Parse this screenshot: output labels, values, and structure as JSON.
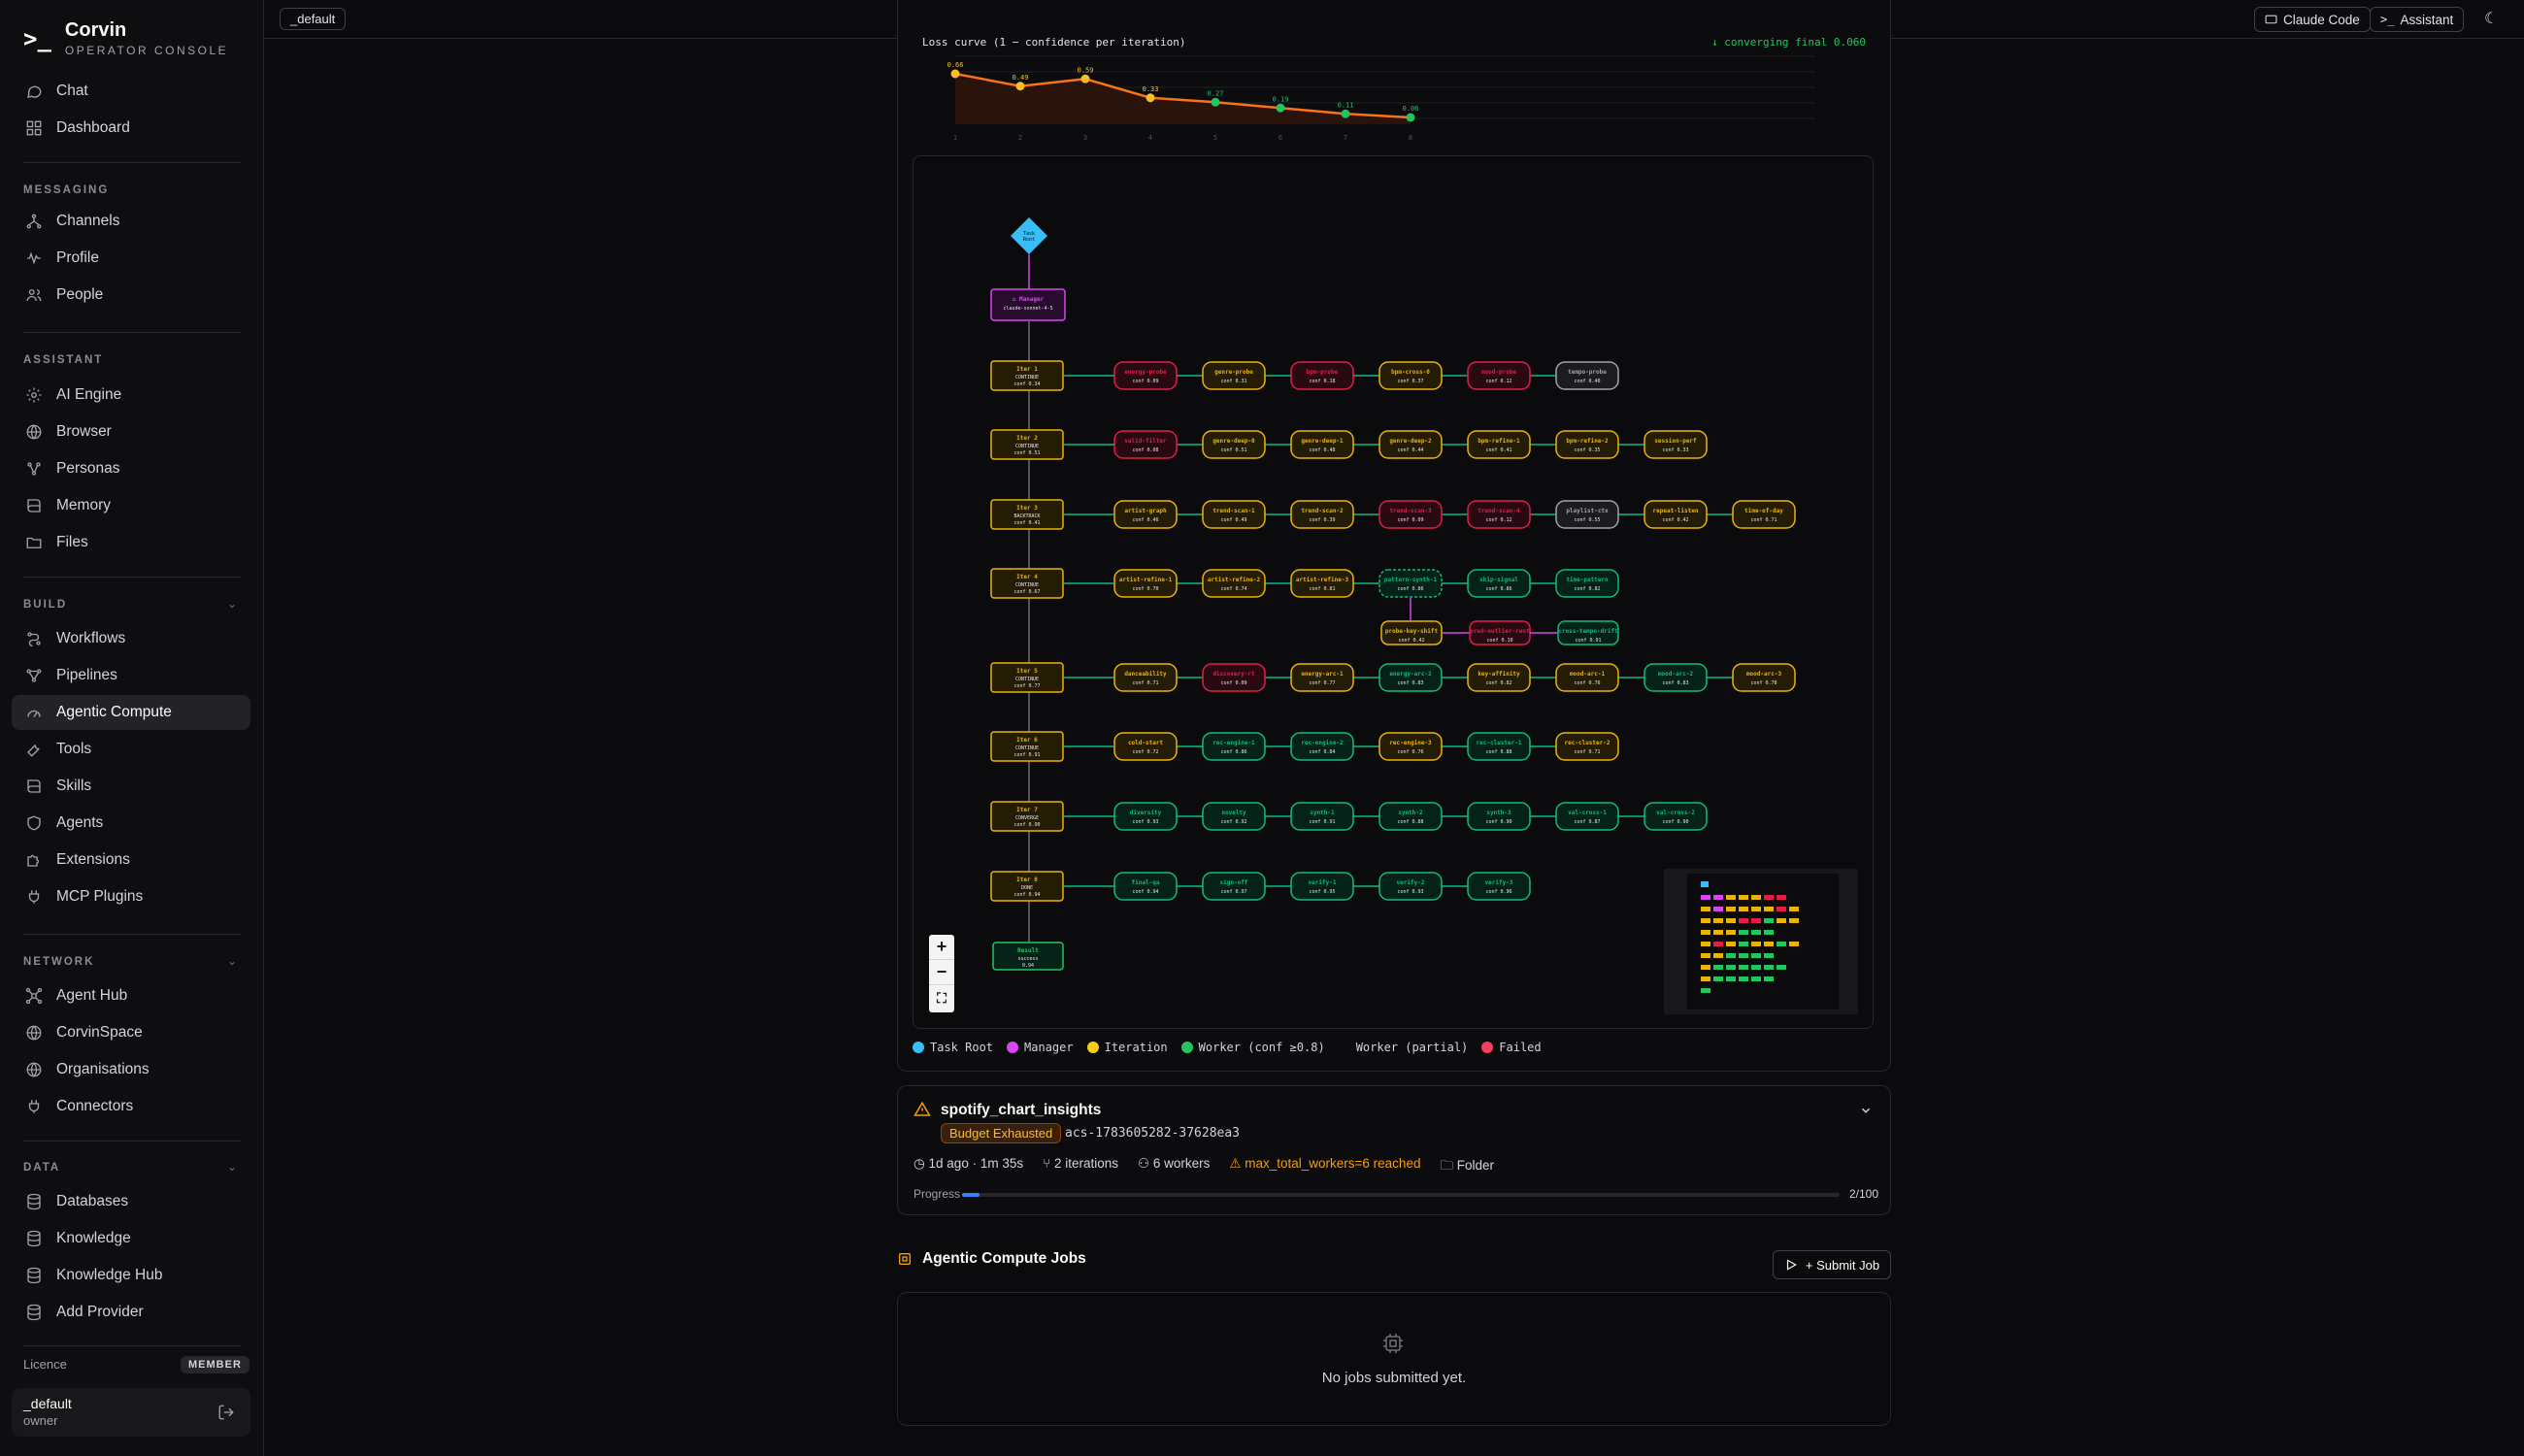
{
  "brand": {
    "mark": ">_",
    "name": "Corvin",
    "subtitle": "OPERATOR CONSOLE"
  },
  "nav": {
    "top": [
      {
        "label": "Chat",
        "icon": "chat-icon"
      },
      {
        "label": "Dashboard",
        "icon": "dashboard-icon"
      }
    ],
    "messaging": {
      "label": "MESSAGING",
      "items": [
        {
          "label": "Channels",
          "icon": "channels-icon"
        },
        {
          "label": "Profile",
          "icon": "profile-icon"
        },
        {
          "label": "People",
          "icon": "people-icon"
        }
      ]
    },
    "assistant": {
      "label": "ASSISTANT",
      "items": [
        {
          "label": "AI Engine",
          "icon": "ai-engine-icon"
        },
        {
          "label": "Browser",
          "icon": "globe-icon"
        },
        {
          "label": "Personas",
          "icon": "personas-icon"
        },
        {
          "label": "Memory",
          "icon": "book-icon"
        },
        {
          "label": "Files",
          "icon": "folder-icon"
        }
      ]
    },
    "build": {
      "label": "BUILD",
      "items": [
        {
          "label": "Workflows",
          "icon": "workflows-icon"
        },
        {
          "label": "Pipelines",
          "icon": "pipelines-icon"
        },
        {
          "label": "Agentic Compute",
          "icon": "gauge-icon",
          "active": true
        },
        {
          "label": "Tools",
          "icon": "wrench-icon"
        },
        {
          "label": "Skills",
          "icon": "book-icon"
        },
        {
          "label": "Agents",
          "icon": "shield-icon"
        },
        {
          "label": "Extensions",
          "icon": "puzzle-icon"
        },
        {
          "label": "MCP Plugins",
          "icon": "plug-icon"
        }
      ]
    },
    "network": {
      "label": "NETWORK",
      "items": [
        {
          "label": "Agent Hub",
          "icon": "hub-icon"
        },
        {
          "label": "CorvinSpace",
          "icon": "globe-icon"
        },
        {
          "label": "Organisations",
          "icon": "globe-icon"
        },
        {
          "label": "Connectors",
          "icon": "plug-icon"
        }
      ]
    },
    "data": {
      "label": "DATA",
      "items": [
        {
          "label": "Databases",
          "icon": "database-icon"
        },
        {
          "label": "Knowledge",
          "icon": "database-icon"
        },
        {
          "label": "Knowledge Hub",
          "icon": "database-icon"
        },
        {
          "label": "Add Provider",
          "icon": "database-icon"
        }
      ]
    }
  },
  "licence": {
    "label": "Licence",
    "tier": "MEMBER"
  },
  "user": {
    "name": "_default",
    "role": "owner"
  },
  "topbar": {
    "workspace": "_default",
    "claude_code": "Claude Code",
    "assistant": "Assistant"
  },
  "loss": {
    "title": "Loss curve (1 − confidence per iteration)",
    "status": "↓ converging  final 0.060"
  },
  "chart_data": {
    "type": "line",
    "title": "Loss curve (1 − confidence per iteration)",
    "x": [
      1,
      2,
      3,
      4,
      5,
      6,
      7,
      8
    ],
    "values": [
      0.66,
      0.49,
      0.59,
      0.33,
      0.27,
      0.19,
      0.11,
      0.06
    ],
    "point_labels": [
      "0.66",
      "0.49",
      "0.59",
      "0.33",
      "0.27",
      "0.19",
      "0.11",
      "0.06"
    ],
    "colors": {
      "line": "#f97316",
      "high": "#fbbf24",
      "low": "#22c55e"
    }
  },
  "graph": {
    "root": {
      "label": "Task",
      "sub": "Root"
    },
    "manager": {
      "label": "⌂ Manager",
      "sub": "claude-sonnet-4-5"
    },
    "iterations": [
      {
        "label": "Iter 1",
        "state": "CONTINUE",
        "conf": "conf 0.34",
        "workers": [
          [
            "energy-probe",
            "conf 0.09",
            "f"
          ],
          [
            "genre-probe",
            "conf 0.31",
            "w"
          ],
          [
            "bpm-probe",
            "conf 0.18",
            "f"
          ],
          [
            "bpm-cross-0",
            "conf 0.37",
            "w"
          ],
          [
            "mood-probe",
            "conf 0.12",
            "f"
          ],
          [
            "tempo-probe",
            "conf 0.40",
            "p"
          ]
        ]
      },
      {
        "label": "Iter 2",
        "state": "CONTINUE",
        "conf": "conf 0.51",
        "workers": [
          [
            "valid-filter",
            "conf 0.08",
            "f"
          ],
          [
            "genre-deep-0",
            "conf 0.51",
            "w"
          ],
          [
            "genre-deep-1",
            "conf 0.48",
            "w"
          ],
          [
            "genre-deep-2",
            "conf 0.44",
            "w"
          ],
          [
            "bpm-refine-1",
            "conf 0.41",
            "w"
          ],
          [
            "bpm-refine-2",
            "conf 0.35",
            "w"
          ],
          [
            "session-perf",
            "conf 0.33",
            "w"
          ]
        ]
      },
      {
        "label": "Iter 3",
        "state": "BACKTRACK",
        "conf": "conf 0.41",
        "workers": [
          [
            "artist-graph",
            "conf 0.46",
            "w"
          ],
          [
            "trend-scan-1",
            "conf 0.49",
            "w"
          ],
          [
            "trend-scan-2",
            "conf 0.39",
            "w"
          ],
          [
            "trend-scan-3",
            "conf 0.09",
            "f"
          ],
          [
            "trend-scan-4",
            "conf 0.12",
            "f"
          ],
          [
            "playlist-ctx",
            "conf 0.55",
            "p"
          ],
          [
            "repeat-listen",
            "conf 0.42",
            "w"
          ],
          [
            "time-of-day",
            "conf 0.71",
            "w"
          ]
        ]
      },
      {
        "label": "Iter 4",
        "state": "CONTINUE",
        "conf": "conf 0.67",
        "workers": [
          [
            "artist-refine-1",
            "conf 0.70",
            "w"
          ],
          [
            "artist-refine-2",
            "conf 0.74",
            "w"
          ],
          [
            "artist-refine-3",
            "conf 0.81",
            "w"
          ],
          [
            "pattern-synth-1",
            "conf 0.86",
            "g"
          ],
          [
            "skip-signal",
            "conf 0.86",
            "g"
          ],
          [
            "time-pattern",
            "conf 0.82",
            "g"
          ]
        ]
      },
      {
        "label": "Iter 5",
        "state": "CONTINUE",
        "conf": "conf 0.77",
        "workers": [
          [
            "danceability",
            "conf 0.71",
            "w"
          ],
          [
            "discovery-rt",
            "conf 0.09",
            "f"
          ],
          [
            "energy-arc-1",
            "conf 0.77",
            "w"
          ],
          [
            "energy-arc-2",
            "conf 0.83",
            "g"
          ],
          [
            "key-affinity",
            "conf 0.82",
            "w"
          ],
          [
            "mood-arc-1",
            "conf 0.76",
            "w"
          ],
          [
            "mood-arc-2",
            "conf 0.83",
            "g"
          ],
          [
            "mood-arc-3",
            "conf 0.78",
            "w"
          ]
        ]
      },
      {
        "label": "Iter 6",
        "state": "CONTINUE",
        "conf": "conf 0.91",
        "workers": [
          [
            "cold-start",
            "conf 0.72",
            "w"
          ],
          [
            "rec-engine-1",
            "conf 0.86",
            "g"
          ],
          [
            "rec-engine-2",
            "conf 0.84",
            "g"
          ],
          [
            "rec-engine-3",
            "conf 0.76",
            "w"
          ],
          [
            "rec-cluster-1",
            "conf 0.88",
            "g"
          ],
          [
            "rec-cluster-2",
            "conf 0.71",
            "w"
          ]
        ]
      },
      {
        "label": "Iter 7",
        "state": "CONVERGE",
        "conf": "conf 0.90",
        "workers": [
          [
            "diversity",
            "conf 0.93",
            "g"
          ],
          [
            "novelty",
            "conf 0.92",
            "g"
          ],
          [
            "synth-1",
            "conf 0.91",
            "g"
          ],
          [
            "synth-2",
            "conf 0.88",
            "g"
          ],
          [
            "synth-3",
            "conf 0.90",
            "g"
          ],
          [
            "val-cross-1",
            "conf 0.87",
            "g"
          ],
          [
            "val-cross-2",
            "conf 0.90",
            "g"
          ]
        ]
      },
      {
        "label": "Iter 8",
        "state": "DONE",
        "conf": "conf 0.94",
        "workers": [
          [
            "final-qa",
            "conf 0.94",
            "g"
          ],
          [
            "sign-off",
            "conf 0.97",
            "g"
          ],
          [
            "verify-1",
            "conf 0.95",
            "g"
          ],
          [
            "verify-2",
            "conf 0.93",
            "g"
          ],
          [
            "verify-3",
            "conf 0.96",
            "g"
          ]
        ]
      }
    ],
    "sub_workers": [
      [
        "probe-key-shift",
        "conf 0.42",
        "w"
      ],
      [
        "pred-outlier-rest",
        "conf 0.10",
        "f"
      ],
      [
        "cross-tempo-drift",
        "conf 0.91",
        "g"
      ]
    ],
    "result": {
      "label": "Result",
      "sub": "success",
      "conf": "0.94"
    },
    "minimap_rows": [
      [
        1,
        1,
        2,
        2,
        2,
        3,
        3,
        0
      ],
      [
        2,
        1,
        2,
        2,
        2,
        2,
        3,
        2
      ],
      [
        2,
        2,
        2,
        3,
        3,
        4,
        2,
        2
      ],
      [
        2,
        2,
        2,
        4,
        4,
        4,
        0,
        0
      ],
      [
        2,
        3,
        2,
        4,
        2,
        2,
        4,
        2
      ],
      [
        2,
        2,
        4,
        4,
        4,
        4,
        0,
        0
      ],
      [
        2,
        4,
        4,
        4,
        4,
        4,
        4,
        0
      ],
      [
        2,
        4,
        4,
        4,
        4,
        4,
        0,
        0
      ],
      [
        4,
        0,
        0,
        0,
        0,
        0,
        0,
        0
      ]
    ]
  },
  "legend": [
    {
      "label": "Task Root",
      "color": "#38bdf8"
    },
    {
      "label": "Manager",
      "color": "#d946ef"
    },
    {
      "label": "Iteration",
      "color": "#facc15"
    },
    {
      "label": "Worker (conf ≥0.8)",
      "color": "#22c55e"
    },
    {
      "label": "Worker (partial)",
      "color": "#0b0b0e"
    },
    {
      "label": "Failed",
      "color": "#f43f5e"
    }
  ],
  "job": {
    "name": "spotify_chart_insights",
    "status": "Budget Exhausted",
    "id": "acs-1783605282-37628ea3",
    "time": "1d ago · 1m 35s",
    "iterations": "2 iterations",
    "workers": "6 workers",
    "warning": "max_total_workers=6 reached",
    "folder": "Folder",
    "progress_label": "Progress",
    "progress": 0.02,
    "progress_count": "2/100"
  },
  "jobs": {
    "title": "Agentic Compute Jobs",
    "submit": "+ Submit Job",
    "empty": "No jobs submitted yet."
  }
}
